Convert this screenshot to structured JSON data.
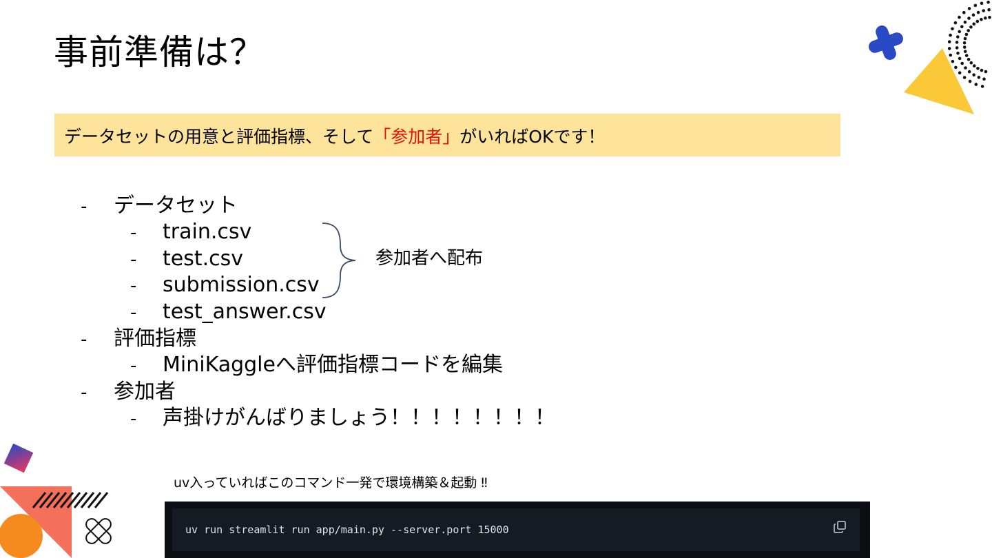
{
  "slide": {
    "title": "事前準備は？",
    "callout": {
      "before": "データセットの用意と評価指標、そして",
      "highlight": "「参加者」",
      "after": "がいればOKです！"
    },
    "bullet_marker": "-",
    "items": [
      {
        "label": "データセット",
        "children": [
          "train.csv",
          "test.csv",
          "submission.csv",
          "test_answer.csv"
        ]
      },
      {
        "label": "評価指標",
        "children": [
          "MiniKaggleへ評価指標コードを編集"
        ]
      },
      {
        "label": "参加者",
        "children": [
          "声掛けがんばりましょう！！！！！！！！"
        ]
      }
    ],
    "brace_label": "参加者へ配布",
    "command_caption": "uv入っていればこのコマンド一発で環境構築＆起動 ‼",
    "command": "uv run streamlit run app/main.py --server.port 15000",
    "copy_icon": "copy-icon",
    "colors": {
      "callout_bg": "#fde49a",
      "highlight": "#e8120c",
      "code_bg": "#151b23",
      "deco_blue": "#2a49c4",
      "deco_yellow": "#fbc838",
      "deco_coral": "#f4705a",
      "deco_orange": "#f58a1f"
    }
  }
}
